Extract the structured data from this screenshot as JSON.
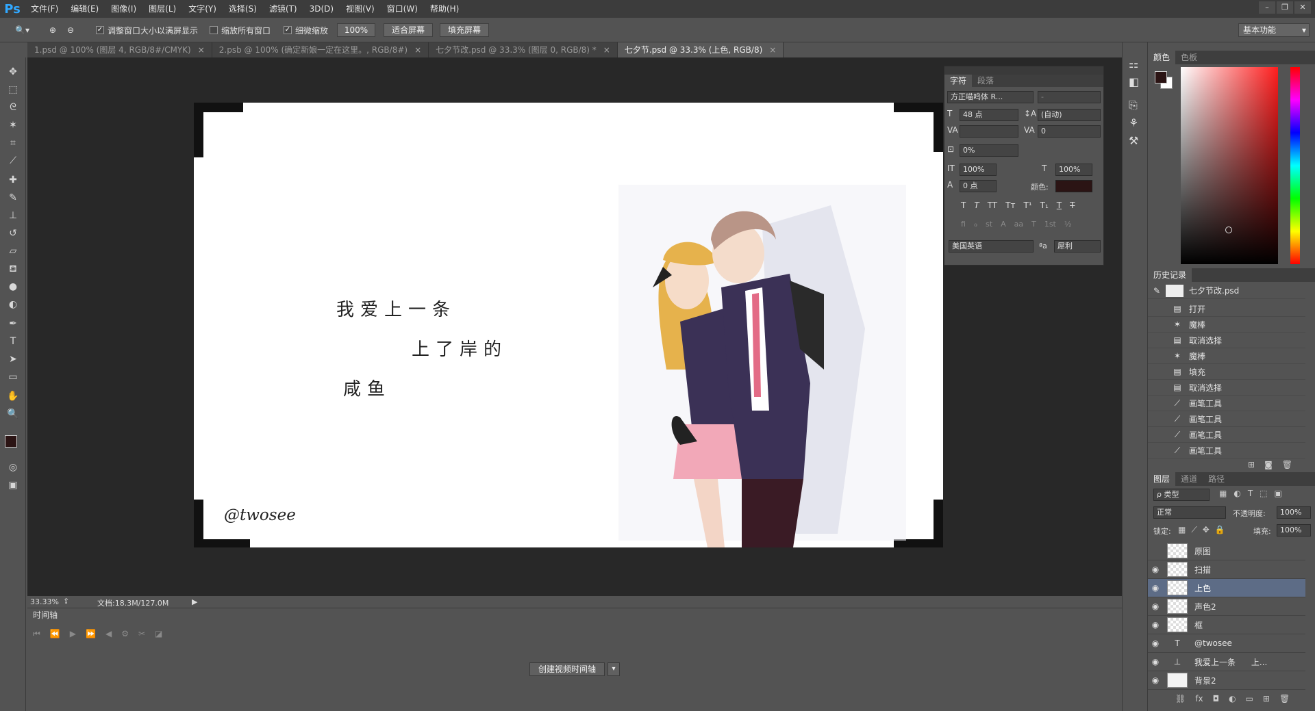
{
  "app": {
    "logo": "Ps"
  },
  "menu": [
    "文件(F)",
    "编辑(E)",
    "图像(I)",
    "图层(L)",
    "文字(Y)",
    "选择(S)",
    "滤镜(T)",
    "3D(D)",
    "视图(V)",
    "窗口(W)",
    "帮助(H)"
  ],
  "options": {
    "resize_windows": "调整窗口大小以满屏显示",
    "zoom_all": "缩放所有窗口",
    "scrubby_zoom": "细微缩放",
    "zoom_value": "100%",
    "fit_screen": "适合屏幕",
    "fill_screen": "填充屏幕",
    "workspace": "基本功能"
  },
  "tabs": [
    {
      "label": "1.psd @ 100% (图层 4, RGB/8#/CMYK)",
      "close": "×"
    },
    {
      "label": "2.psb @ 100% (确定新娘一定在这里。, RGB/8#)",
      "close": "×"
    },
    {
      "label": "七夕节改.psd @ 33.3% (图层 0, RGB/8) *",
      "close": "×"
    },
    {
      "label": "七夕节.psd @ 33.3% (上色, RGB/8)",
      "close": "×"
    }
  ],
  "canvas": {
    "text_lines": [
      "我爱上一条",
      "上了岸的",
      "咸鱼"
    ],
    "signature": "@twosee"
  },
  "status": {
    "zoom": "33.33%",
    "doc": "文档:18.3M/127.0M"
  },
  "timeline": {
    "title": "时间轴",
    "create_button": "创建视频时间轴"
  },
  "character_panel": {
    "tabs": [
      "字符",
      "段落"
    ],
    "font": "方正喵呜体 R...",
    "font_style": "-",
    "size": "48 点",
    "leading": "(自动)",
    "tracking": "0",
    "scale_pct": "0%",
    "vertical_scale": "100%",
    "horizontal_scale": "100%",
    "baseline": "0 点",
    "color_label": "颜色:",
    "language": "美国英语",
    "aa_label": "ªa",
    "antialias": "犀利"
  },
  "color_panel": {
    "tabs": [
      "颜色",
      "色板"
    ],
    "foreground": "#2b1414"
  },
  "history_panel": {
    "tab": "历史记录",
    "snapshot": "七夕节改.psd",
    "items": [
      "打开",
      "魔棒",
      "取消选择",
      "魔棒",
      "填充",
      "取消选择",
      "画笔工具",
      "画笔工具",
      "画笔工具",
      "画笔工具"
    ]
  },
  "layers_panel": {
    "tabs": [
      "图层",
      "通道",
      "路径"
    ],
    "kind_filter": "ρ 类型",
    "blend_mode": "正常",
    "opacity_label": "不透明度:",
    "opacity": "100%",
    "lock_label": "锁定:",
    "fill_label": "填充:",
    "fill": "100%",
    "layers": [
      {
        "name": "原图",
        "visible": false
      },
      {
        "name": "扫描",
        "visible": true
      },
      {
        "name": "上色",
        "visible": true,
        "selected": true
      },
      {
        "name": "声色2",
        "visible": true
      },
      {
        "name": "框",
        "visible": true
      },
      {
        "name": "@twosee",
        "visible": true,
        "type": "text"
      },
      {
        "name": "我爱上一条      上...",
        "visible": true,
        "type": "text"
      },
      {
        "name": "背景2",
        "visible": true
      }
    ]
  },
  "colors": {
    "accent": "#31a8ff",
    "selected_layer": "#5d6c86"
  }
}
